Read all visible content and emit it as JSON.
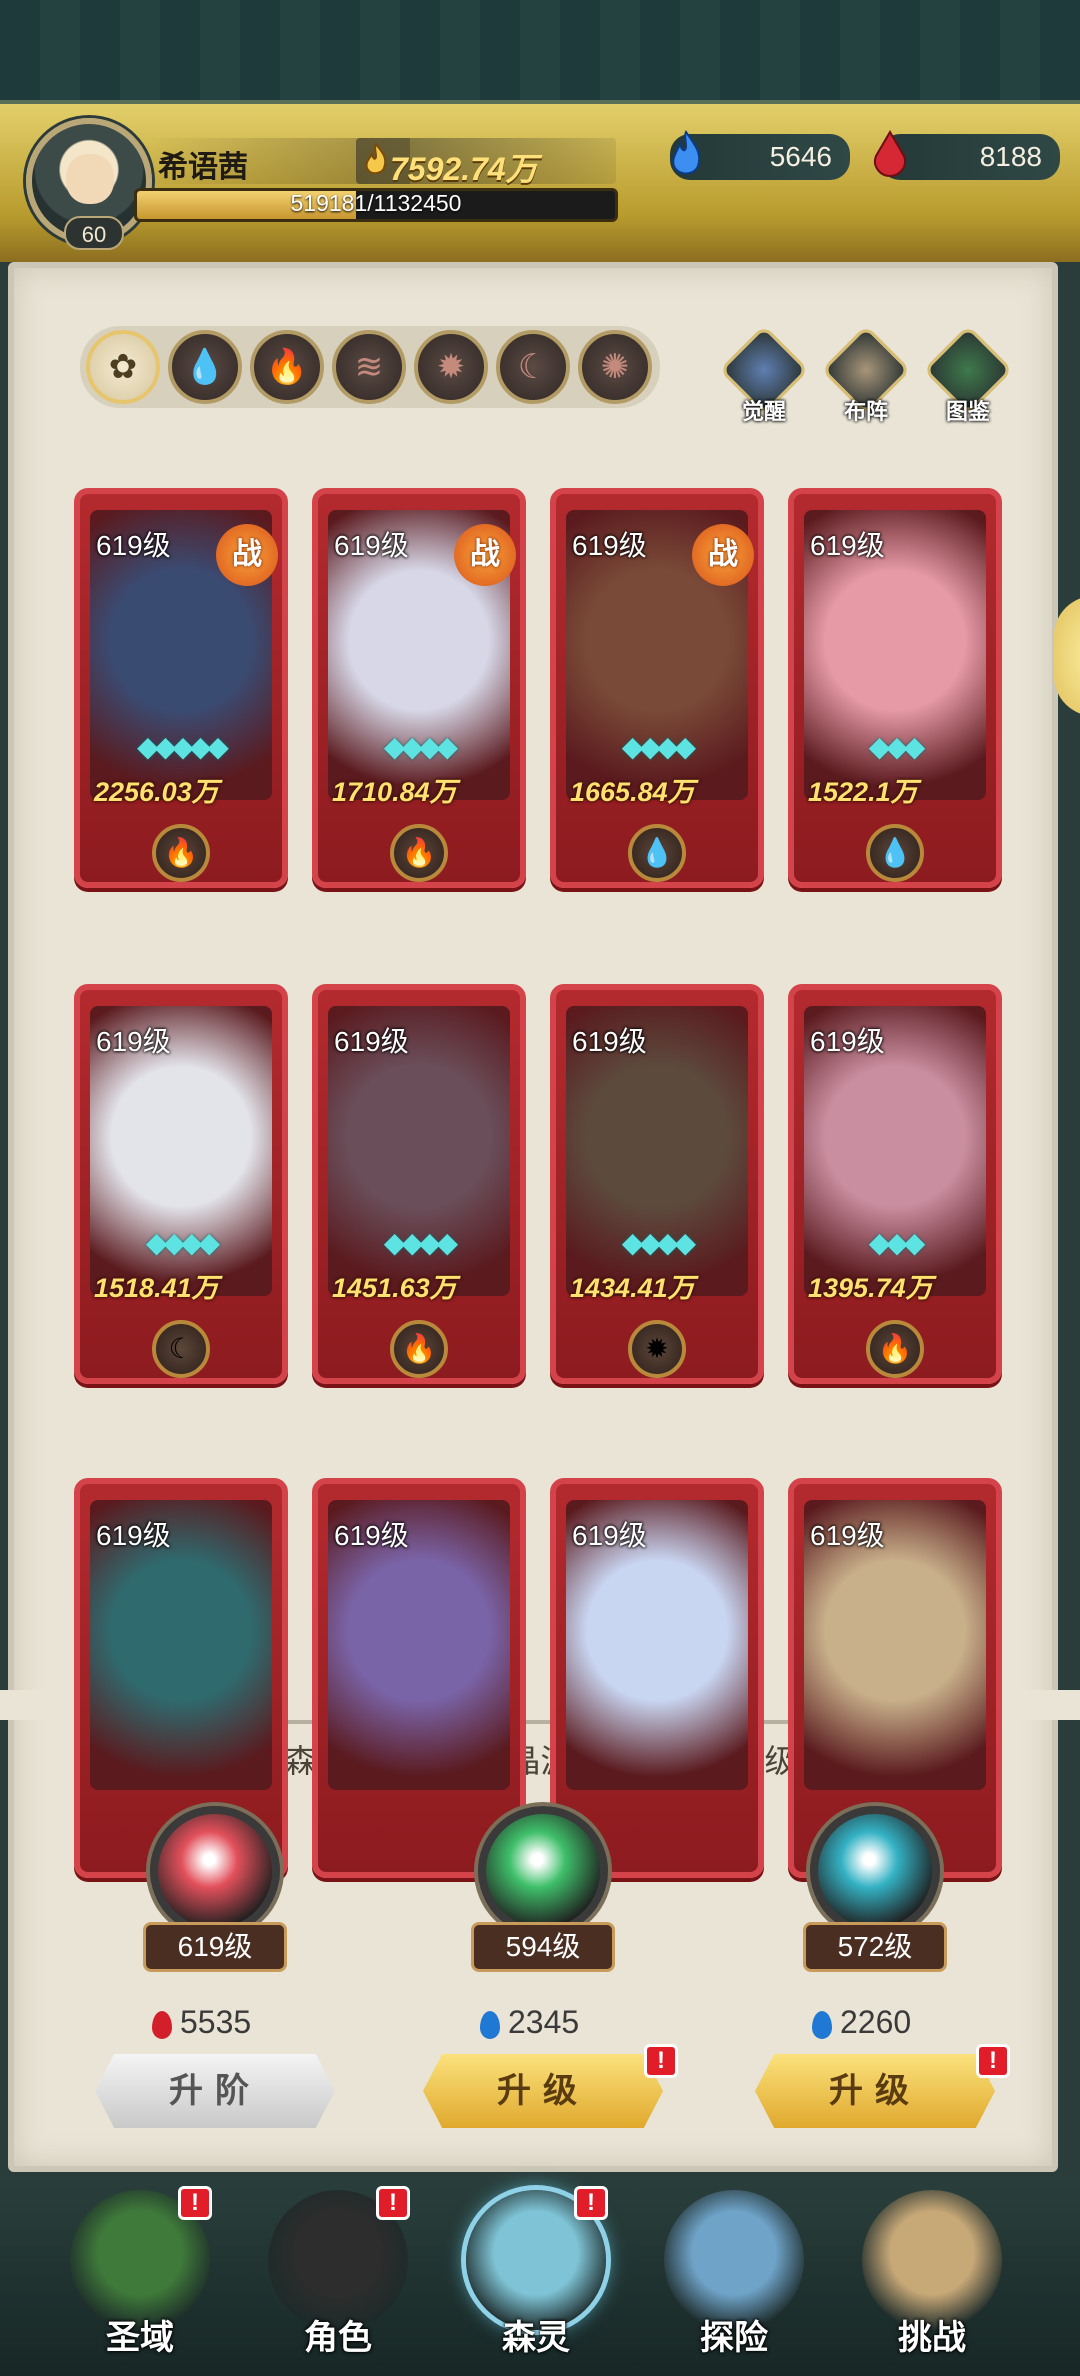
{
  "player": {
    "name": "希语茜",
    "level": "60",
    "gold": "7592.74万",
    "xp_text": "519181/1132450",
    "xp_fraction": 0.4585
  },
  "resources": [
    {
      "icon": "blue-flame-icon",
      "value": "5646"
    },
    {
      "icon": "red-drop-icon",
      "value": "8188"
    }
  ],
  "filters": [
    {
      "icon": "all-icon",
      "glyph": "✿",
      "active": true
    },
    {
      "icon": "water-icon",
      "glyph": "💧"
    },
    {
      "icon": "fire-icon",
      "glyph": "🔥"
    },
    {
      "icon": "wind-icon",
      "glyph": "≋"
    },
    {
      "icon": "light-icon",
      "glyph": "✹"
    },
    {
      "icon": "moon-icon",
      "glyph": "☾"
    },
    {
      "icon": "void-icon",
      "glyph": "✺"
    }
  ],
  "side_buttons": [
    {
      "icon": "awaken-icon",
      "label": "觉醒"
    },
    {
      "icon": "formation-icon",
      "label": "布阵"
    },
    {
      "icon": "codex-icon",
      "label": "图鉴"
    }
  ],
  "cards": [
    {
      "level": "619级",
      "power": "2256.03万",
      "battle": "战",
      "stars": "◆◆◆◆◆",
      "element": "fire-icon",
      "glyph": "🔥",
      "color": "#3a4b72"
    },
    {
      "level": "619级",
      "power": "1710.84万",
      "battle": "战",
      "stars": "◆◆◆◆",
      "element": "fire-icon",
      "glyph": "🔥",
      "color": "#d7d7e7"
    },
    {
      "level": "619级",
      "power": "1665.84万",
      "battle": "战",
      "stars": "◆◆◆◆",
      "element": "water-icon",
      "glyph": "💧",
      "color": "#7a4a38"
    },
    {
      "level": "619级",
      "power": "1522.1万",
      "battle": "",
      "stars": "◆◆◆",
      "element": "water-icon",
      "glyph": "💧",
      "color": "#e59aa6"
    },
    {
      "level": "619级",
      "power": "1518.41万",
      "battle": "",
      "stars": "◆◆◆◆",
      "element": "moon-icon",
      "glyph": "☾",
      "color": "#e3e3ea"
    },
    {
      "level": "619级",
      "power": "1451.63万",
      "battle": "",
      "stars": "◆◆◆◆",
      "element": "fire-icon",
      "glyph": "🔥",
      "color": "#6a4f5b"
    },
    {
      "level": "619级",
      "power": "1434.41万",
      "battle": "",
      "stars": "◆◆◆◆",
      "element": "light-icon",
      "glyph": "✹",
      "color": "#5c4a3d"
    },
    {
      "level": "619级",
      "power": "1395.74万",
      "battle": "",
      "stars": "◆◆◆",
      "element": "fire-icon",
      "glyph": "🔥",
      "color": "#c98ea0"
    },
    {
      "level": "619级",
      "power": "",
      "battle": "",
      "stars": "",
      "element": "",
      "glyph": "",
      "color": "#2f6a6e"
    },
    {
      "level": "619级",
      "power": "",
      "battle": "",
      "stars": "",
      "element": "",
      "glyph": "",
      "color": "#7a64a8"
    },
    {
      "level": "619级",
      "power": "",
      "battle": "",
      "stars": "",
      "element": "",
      "glyph": "",
      "color": "#c9d6f2"
    },
    {
      "level": "619级",
      "power": "",
      "battle": "",
      "stars": "",
      "element": "",
      "glyph": "",
      "color": "#c8b08a"
    }
  ],
  "shared_text": "所有森灵共享【共鸣晶源】中的最高等级!",
  "info_glyph": "i",
  "crystals": [
    {
      "level": "619级",
      "cost": "5535",
      "cost_color": "#d21f2a",
      "button": "升阶",
      "style": "grey",
      "badge": "",
      "orb_color": "#e2505b"
    },
    {
      "level": "594级",
      "cost": "2345",
      "cost_color": "#1f78d4",
      "button": "升级",
      "style": "gold",
      "badge": "!",
      "orb_color": "#3fbf6a"
    },
    {
      "level": "572级",
      "cost": "2260",
      "cost_color": "#1f78d4",
      "button": "升级",
      "style": "gold",
      "badge": "!",
      "orb_color": "#34b2c4"
    }
  ],
  "nav": [
    {
      "label": "圣域",
      "icon": "tree-icon",
      "badge": "!",
      "active": false,
      "color": "#3f7a3a"
    },
    {
      "label": "角色",
      "icon": "character-icon",
      "badge": "!",
      "active": false,
      "color": "#2d2d2d"
    },
    {
      "label": "森灵",
      "icon": "spirit-icon",
      "badge": "!",
      "active": true,
      "color": "#7fc4d6"
    },
    {
      "label": "探险",
      "icon": "explore-icon",
      "badge": "",
      "active": false,
      "color": "#6fa3c8"
    },
    {
      "label": "挑战",
      "icon": "challenge-icon",
      "badge": "",
      "active": false,
      "color": "#c7a877"
    }
  ]
}
